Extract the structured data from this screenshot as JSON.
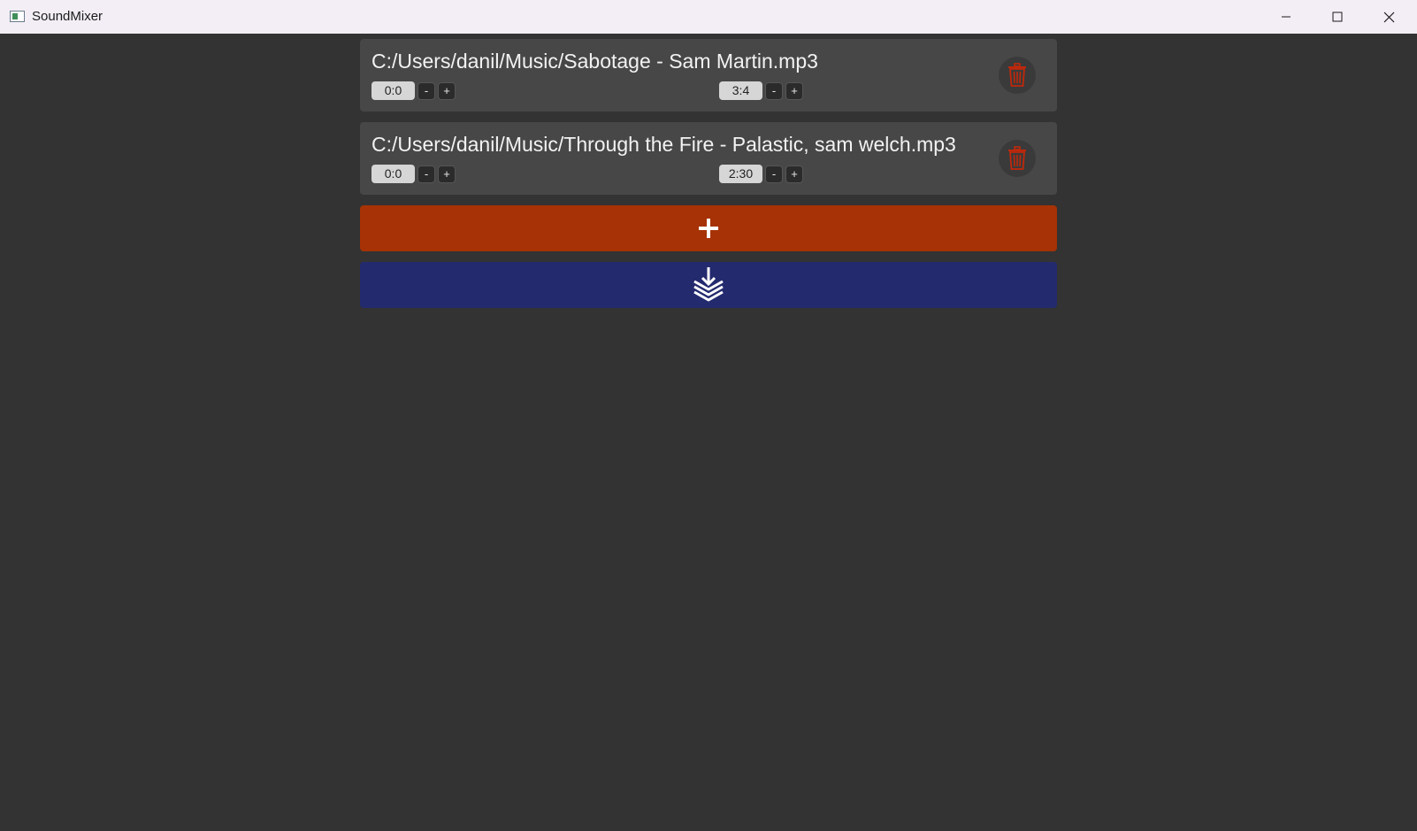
{
  "window": {
    "title": "SoundMixer",
    "icons": {
      "app": "app-icon",
      "minimize": "minimize-icon",
      "maximize": "maximize-icon",
      "close": "close-icon"
    }
  },
  "tracks": [
    {
      "path": "C:/Users/danil/Music/Sabotage - Sam Martin.mp3",
      "start": "0:0",
      "end": "3:4",
      "minus_label": "-",
      "plus_label": "+"
    },
    {
      "path": "C:/Users/danil/Music/Through the Fire - Palastic, sam welch.mp3",
      "start": "0:0",
      "end": "2:30",
      "minus_label": "-",
      "plus_label": "+"
    }
  ],
  "actions": {
    "add_icon": "plus-icon",
    "export_icon": "download-layers-icon",
    "delete_icon": "trash-icon"
  },
  "colors": {
    "background": "#333333",
    "track_card": "#474747",
    "add_button": "#a63205",
    "export_button": "#232a6e",
    "delete_icon": "#c0280a"
  }
}
